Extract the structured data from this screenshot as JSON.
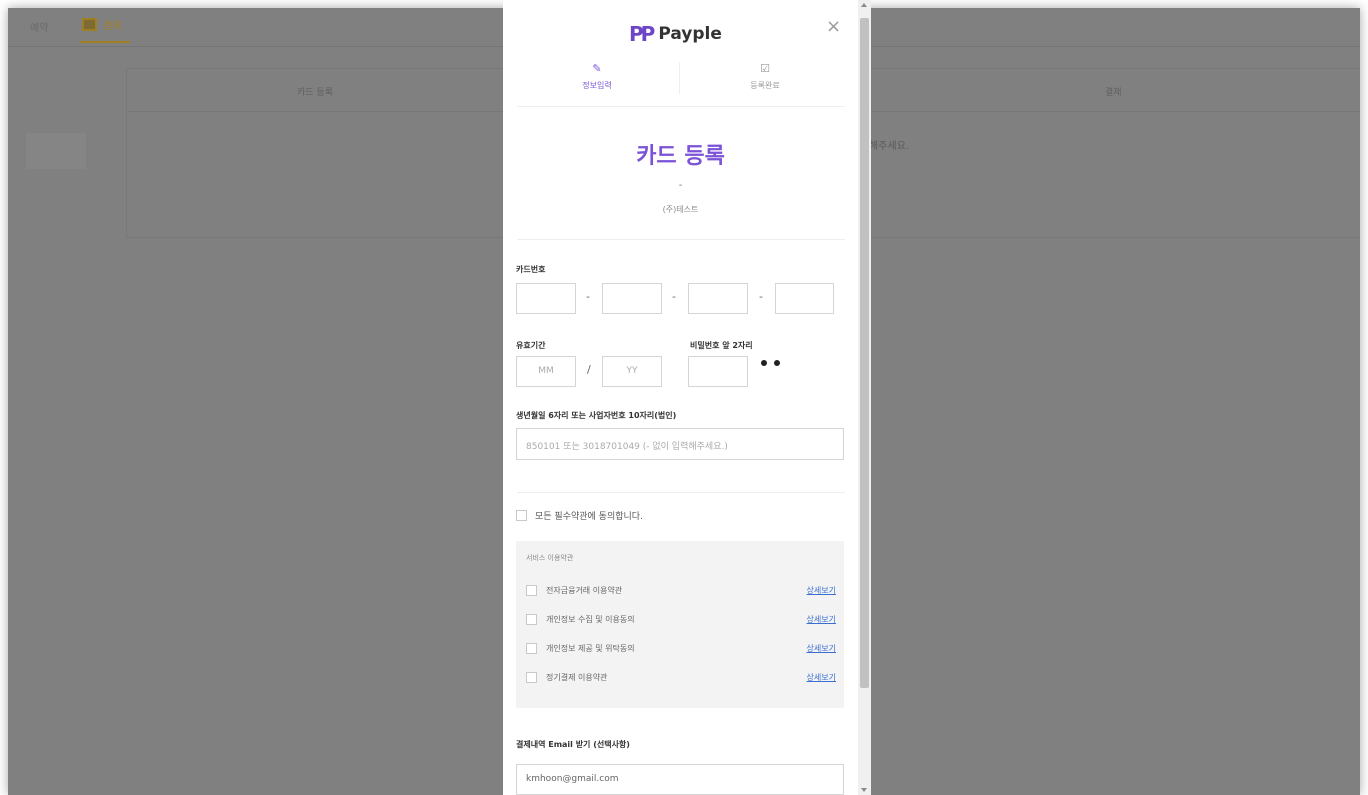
{
  "background": {
    "tab_prev": "예약",
    "tab_active": "결제",
    "table_header_left": "카드 등록",
    "table_header_right": "결제",
    "notice_fragment": "해주세요."
  },
  "popup": {
    "brand": "Payple",
    "brand_mark": "PP",
    "close_symbol": "×",
    "steps": [
      {
        "icon": "✎",
        "label": "정보입력",
        "active": true
      },
      {
        "icon": "☑",
        "label": "등록완료",
        "active": false
      }
    ],
    "title": "카드 등록",
    "dash": "-",
    "company": "(주)테스트",
    "card_number_label": "카드번호",
    "card_separator": "-",
    "expiry_label": "유효기간",
    "month_placeholder": "MM",
    "year_placeholder": "YY",
    "slash": "/",
    "password_label": "비밀번호 앞 2자리",
    "birth_label": "생년월일 6자리 또는 사업자번호 10자리(법인)",
    "birth_placeholder": "850101 또는 3018701049 (- 없이 입력해주세요.)",
    "agree_all": "모든 필수약관에 동의합니다.",
    "terms_header": "서비스 이용약관",
    "terms": [
      {
        "label": "전자금융거래 이용약관",
        "link": "상세보기"
      },
      {
        "label": "개인정보 수집 및 이용동의",
        "link": "상세보기"
      },
      {
        "label": "개인정보 제공 및 위탁동의",
        "link": "상세보기"
      },
      {
        "label": "정기결제 이용약관",
        "link": "상세보기"
      }
    ],
    "email_label": "결제내역 Email 받기 (선택사항)",
    "email_value": "kmhoon@gmail.com"
  },
  "colors": {
    "accent": "#7b52d8",
    "link": "#3a6fcf",
    "overlay": "#808080"
  }
}
